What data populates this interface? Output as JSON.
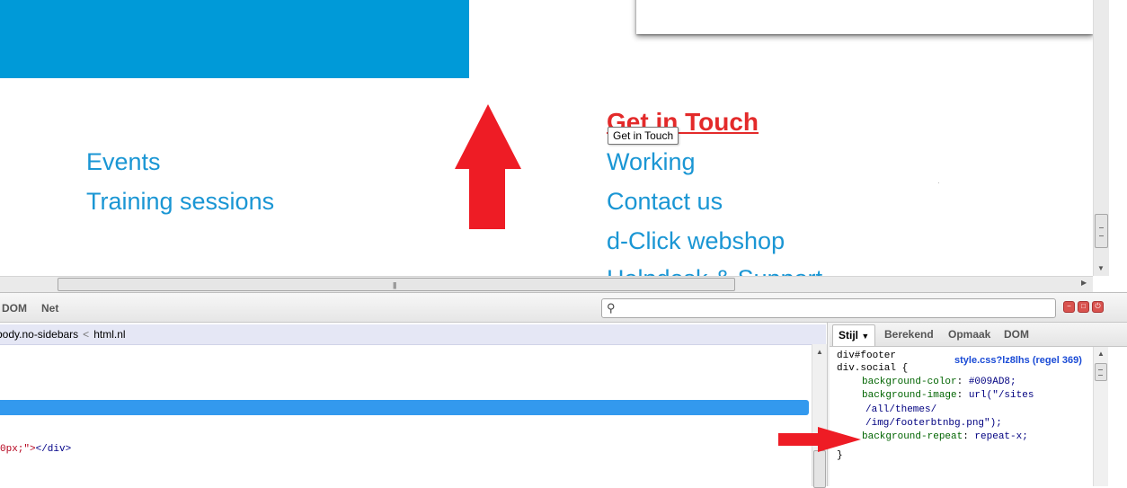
{
  "colors": {
    "accent_blue": "#009AD8",
    "link_blue": "#1a96d4",
    "hover_red": "#e32a2a",
    "annotation_red": "#ee1c25"
  },
  "page": {
    "footer_left_links": [
      "Events",
      "Training sessions"
    ],
    "footer_right_heading": "Get in Touch",
    "tooltip": "Get in Touch",
    "footer_right_links": [
      "Working",
      "Contact us",
      "d-Click webshop",
      "Helpdesk & Support"
    ]
  },
  "devtools": {
    "tabs": [
      "DOM",
      "Net"
    ],
    "search": {
      "value": "",
      "placeholder": ""
    },
    "breadcrumb": [
      "body.no-sidebars",
      "html.nl"
    ],
    "code_snippet": {
      "text": "0px;\">",
      "tag": "</div>"
    },
    "side_tabs": [
      "Stijl",
      "Berekend",
      "Opmaak",
      "DOM"
    ],
    "side_tab_arrow": "▼",
    "css_rule": {
      "selector_1": "div#footer",
      "selector_2": "div.social {",
      "source": "style.css?lz8lhs (regel 369)",
      "declarations": [
        {
          "prop": "background-color",
          "value": "#009AD8;"
        },
        {
          "prop": "background-image",
          "value": "url(\"/sites"
        },
        {
          "prop": "",
          "value": "/all/themes/"
        },
        {
          "prop": "",
          "value": "/img/footerbtnbg.png\");"
        },
        {
          "prop": "background-repeat",
          "value": "repeat-x;"
        }
      ],
      "close": "}"
    }
  },
  "icons": {
    "search": "magnifier-icon",
    "window_buttons": [
      "minimize-icon",
      "detach-icon",
      "close-icon"
    ]
  }
}
